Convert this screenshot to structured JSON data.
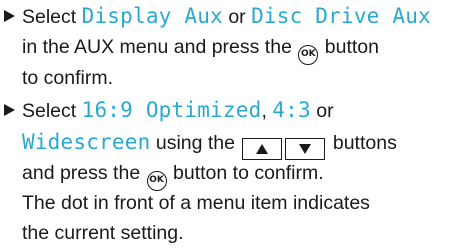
{
  "colors": {
    "text": "#1a1a1a",
    "highlight": "#2aa9d0",
    "background": "#ffffff"
  },
  "step1": {
    "select": "Select",
    "option_display_aux": "Display Aux",
    "or": "or",
    "option_disc_drive_aux": "Disc Drive Aux",
    "in_aux_menu_press": "in the AUX menu and press the",
    "ok_icon_text": "OK",
    "button": "button",
    "to_confirm": "to confirm."
  },
  "step2": {
    "select": "Select",
    "option_16_9": "16:9 Optimized",
    "comma": ",",
    "option_4_3": "4:3",
    "or": "or",
    "option_widescreen": "Widescreen",
    "using_the": "using the",
    "buttons": "buttons",
    "and_press_the": "and press the",
    "ok_icon_text": "OK",
    "button_to_confirm": "button to confirm.",
    "note_line1": "The dot in front of a menu item indicates",
    "note_line2": "the current setting."
  },
  "icons": {
    "bullet": "triangle-right",
    "ok_button": "ok-circle",
    "up_key": "up-arrow-key",
    "down_key": "down-arrow-key"
  }
}
